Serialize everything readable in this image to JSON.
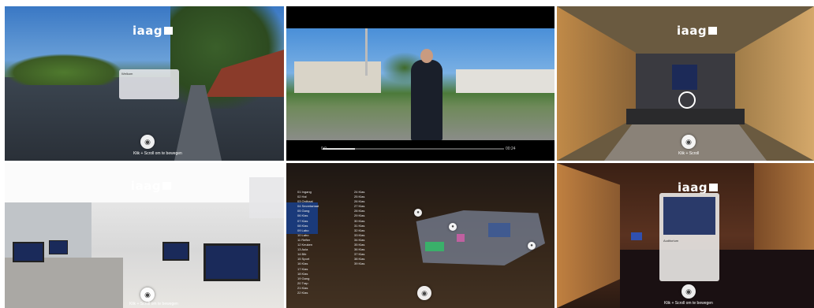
{
  "brand": {
    "logo_text": "iaag",
    "logo_mark": ""
  },
  "panels": [
    {
      "id": "outdoor",
      "caption": "Klik + Scroll om te bewegen",
      "info_card": {
        "title": "Welkom",
        "text": ""
      }
    },
    {
      "id": "video",
      "time_start": "0:0",
      "time_end": "00:24"
    },
    {
      "id": "corridor",
      "caption": "Klik + Scroll"
    },
    {
      "id": "classroom",
      "caption": "Klik + Scroll om te bewegen",
      "menu_items": [
        "",
        "",
        "",
        ""
      ]
    },
    {
      "id": "map",
      "menu_left": [
        "01 Ingang",
        "02 Hal",
        "03 Onthaal",
        "04 Secretariaat",
        "05 Gang",
        "06 Klas",
        "07 Klas",
        "08 Klas",
        "09 Labo",
        "10 Labo",
        "11 Refter",
        "12 Keuken",
        "13 Aula",
        "14 Bib",
        "15 Sport",
        "16 Klas",
        "17 Klas",
        "18 Klas",
        "19 Gang",
        "20 Trap",
        "21 Klas",
        "22 Klas",
        "23 Klas"
      ],
      "menu_right": [
        "24 Klas",
        "25 Klas",
        "26 Klas",
        "27 Klas",
        "28 Klas",
        "29 Klas",
        "30 Klas",
        "31 Klas",
        "32 Klas",
        "33 Klas",
        "34 Klas",
        "35 Klas",
        "36 Klas",
        "37 Klas",
        "38 Klas",
        "39 Klas",
        "40 Klas"
      ]
    },
    {
      "id": "auditorium",
      "caption": "Klik + Scroll om te bewegen",
      "info_card": {
        "title": "Auditorium",
        "text": ""
      }
    }
  ]
}
